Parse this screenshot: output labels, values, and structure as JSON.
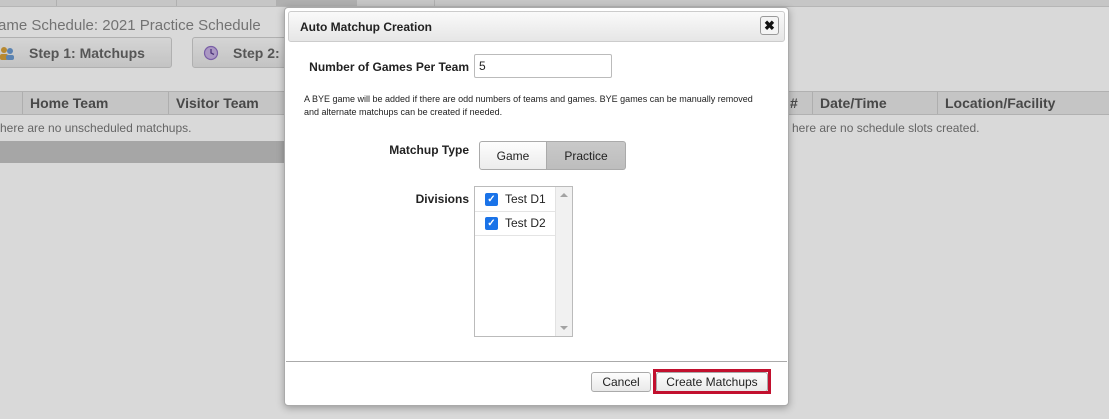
{
  "background": {
    "page_title": "ame Schedule: 2021 Practice Schedule",
    "step1_label": "Step 1: Matchups",
    "step2_label": "Step 2:",
    "left_grid": {
      "columns": [
        "",
        "Home Team",
        "Visitor Team"
      ],
      "empty_text": "here are no unscheduled matchups."
    },
    "right_grid": {
      "columns": [
        "#",
        "Date/Time",
        "Location/Facility"
      ],
      "empty_text": "here are no schedule slots created."
    }
  },
  "dialog": {
    "title": "Auto Matchup Creation",
    "close_icon": "✖",
    "games_per_team_label": "Number of Games Per Team",
    "games_per_team_value": "5",
    "bye_note": "A BYE game will be added if there are odd numbers of teams and games. BYE games can be manually removed and alternate matchups can be created if needed.",
    "matchup_type_label": "Matchup Type",
    "matchup_types": [
      "Game",
      "Practice"
    ],
    "selected_matchup_type": "Practice",
    "divisions_label": "Divisions",
    "divisions": [
      {
        "label": "Test D1",
        "checked": true
      },
      {
        "label": "Test D2",
        "checked": true
      }
    ],
    "cancel_label": "Cancel",
    "create_label": "Create Matchups"
  },
  "colors": {
    "highlight_border": "#c2102e",
    "checkbox_blue": "#1a73e8"
  }
}
